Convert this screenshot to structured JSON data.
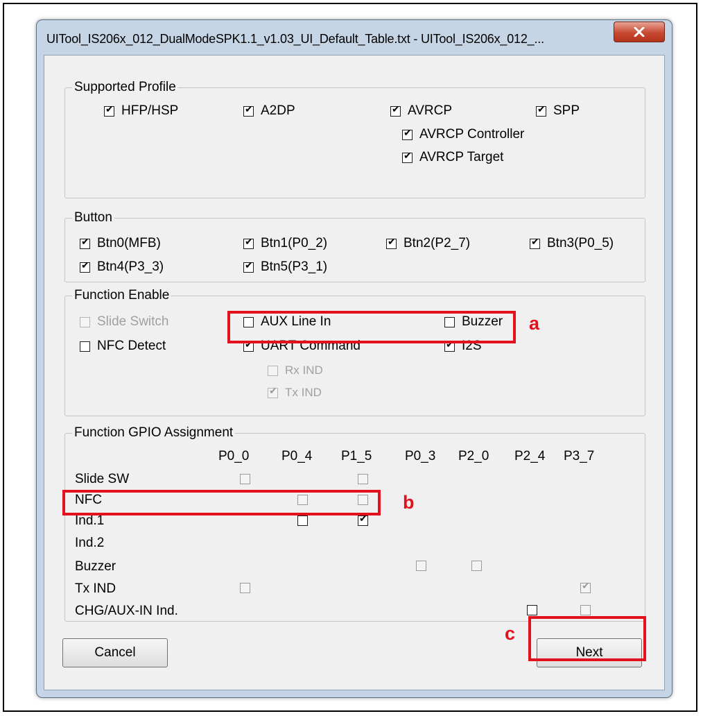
{
  "window": {
    "title": "UITool_IS206x_012_DualModeSPK1.1_v1.03_UI_Default_Table.txt - UITool_IS206x_012_..."
  },
  "supported_profile": {
    "title": "Supported Profile",
    "items": [
      {
        "label": "HFP/HSP",
        "checked": true
      },
      {
        "label": "A2DP",
        "checked": true
      },
      {
        "label": "AVRCP",
        "checked": true
      },
      {
        "label": "SPP",
        "checked": true
      },
      {
        "label": "AVRCP Controller",
        "checked": true
      },
      {
        "label": "AVRCP Target",
        "checked": true
      }
    ]
  },
  "button_group": {
    "title": "Button",
    "items": [
      {
        "label": "Btn0(MFB)",
        "checked": true
      },
      {
        "label": "Btn1(P0_2)",
        "checked": true
      },
      {
        "label": "Btn2(P2_7)",
        "checked": true
      },
      {
        "label": "Btn3(P0_5)",
        "checked": true
      },
      {
        "label": "Btn4(P3_3)",
        "checked": true
      },
      {
        "label": "Btn5(P3_1)",
        "checked": true
      }
    ]
  },
  "function_enable": {
    "title": "Function Enable",
    "items": [
      {
        "label": "Slide Switch",
        "checked": false,
        "enabled": false
      },
      {
        "label": "AUX Line In",
        "checked": false,
        "enabled": true
      },
      {
        "label": "Buzzer",
        "checked": false,
        "enabled": true
      },
      {
        "label": "NFC Detect",
        "checked": false,
        "enabled": true
      },
      {
        "label": "UART Command",
        "checked": true,
        "enabled": true
      },
      {
        "label": "I2S",
        "checked": true,
        "enabled": true
      },
      {
        "label": "Rx IND",
        "checked": false,
        "enabled": false
      },
      {
        "label": "Tx IND",
        "checked": true,
        "enabled": false
      }
    ]
  },
  "gpio": {
    "title": "Function GPIO Assignment",
    "columns": [
      "P0_0",
      "P0_4",
      "P1_5",
      "P0_3",
      "P2_0",
      "P2_4",
      "P3_7"
    ],
    "rows": [
      "Slide SW",
      "NFC",
      "Ind.1",
      "Ind.2",
      "Buzzer",
      "Tx IND",
      "CHG/AUX-IN Ind."
    ],
    "cells": [
      {
        "row": 0,
        "col": 0,
        "checked": false,
        "enabled": false
      },
      {
        "row": 0,
        "col": 2,
        "checked": false,
        "enabled": false
      },
      {
        "row": 1,
        "col": 1,
        "checked": false,
        "enabled": false
      },
      {
        "row": 1,
        "col": 2,
        "checked": false,
        "enabled": false
      },
      {
        "row": 2,
        "col": 1,
        "checked": false,
        "enabled": true
      },
      {
        "row": 2,
        "col": 2,
        "checked": true,
        "enabled": true
      },
      {
        "row": 4,
        "col": 3,
        "checked": false,
        "enabled": false
      },
      {
        "row": 4,
        "col": 4,
        "checked": false,
        "enabled": false
      },
      {
        "row": 5,
        "col": 0,
        "checked": false,
        "enabled": false
      },
      {
        "row": 5,
        "col": 6,
        "checked": true,
        "enabled": false
      },
      {
        "row": 6,
        "col": 5,
        "checked": false,
        "enabled": true
      },
      {
        "row": 6,
        "col": 6,
        "checked": false,
        "enabled": false
      }
    ]
  },
  "buttons": {
    "cancel": "Cancel",
    "next": "Next"
  },
  "annotations": {
    "a": "a",
    "b": "b",
    "c": "c",
    "color": "#e3101d"
  }
}
